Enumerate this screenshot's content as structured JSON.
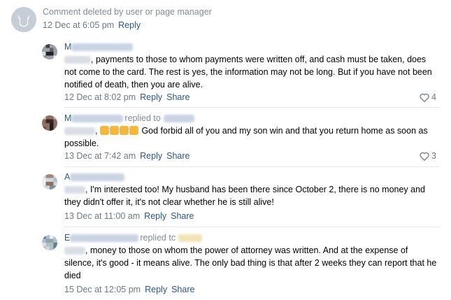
{
  "deleted": {
    "text": "Comment deleted by user or page manager",
    "date": "12 Dec at 6:05 pm",
    "reply": "Reply"
  },
  "comments": [
    {
      "initial": "M",
      "body": ", payments to those to whom payments were written off, and cash must be taken, does not come to the card. The rest is yes, the information may not be long. But if you have not been notified of death, then you are alive.",
      "date": "12 Dec at 8:02 pm",
      "reply": "Reply",
      "share": "Share",
      "likes": "4"
    },
    {
      "initial": "M",
      "replied": "replied to",
      "body": "God forbid all of you and my son win and that you return home as soon as possible.",
      "date": "13 Dec at 7:42 am",
      "reply": "Reply",
      "share": "Share",
      "likes": "3"
    },
    {
      "initial": "A",
      "body": ", I'm interested too! My husband has been there since October 2, there is no money and they didn't offer it, it's not clear whether he is still alive!",
      "date": "13 Dec at 11:00 am",
      "reply": "Reply",
      "share": "Share"
    },
    {
      "initial": "E",
      "replied": "replied tc",
      "body": ", money to those on whom the power of attorney was written. And at the expense of silence, it's good - it means alive. The only bad thing is that after 2 weeks they can report that he died",
      "date": "15 Dec at 12:05 pm",
      "reply": "Reply",
      "share": "Share"
    }
  ],
  "icons": {
    "deleted_avatar": "dog-avatar-icon",
    "like": "heart-icon",
    "emoji": "folded-hands-icon"
  },
  "colors": {
    "link": "#2a5885",
    "muted": "#818c99",
    "divider": "#e7e8ec"
  }
}
